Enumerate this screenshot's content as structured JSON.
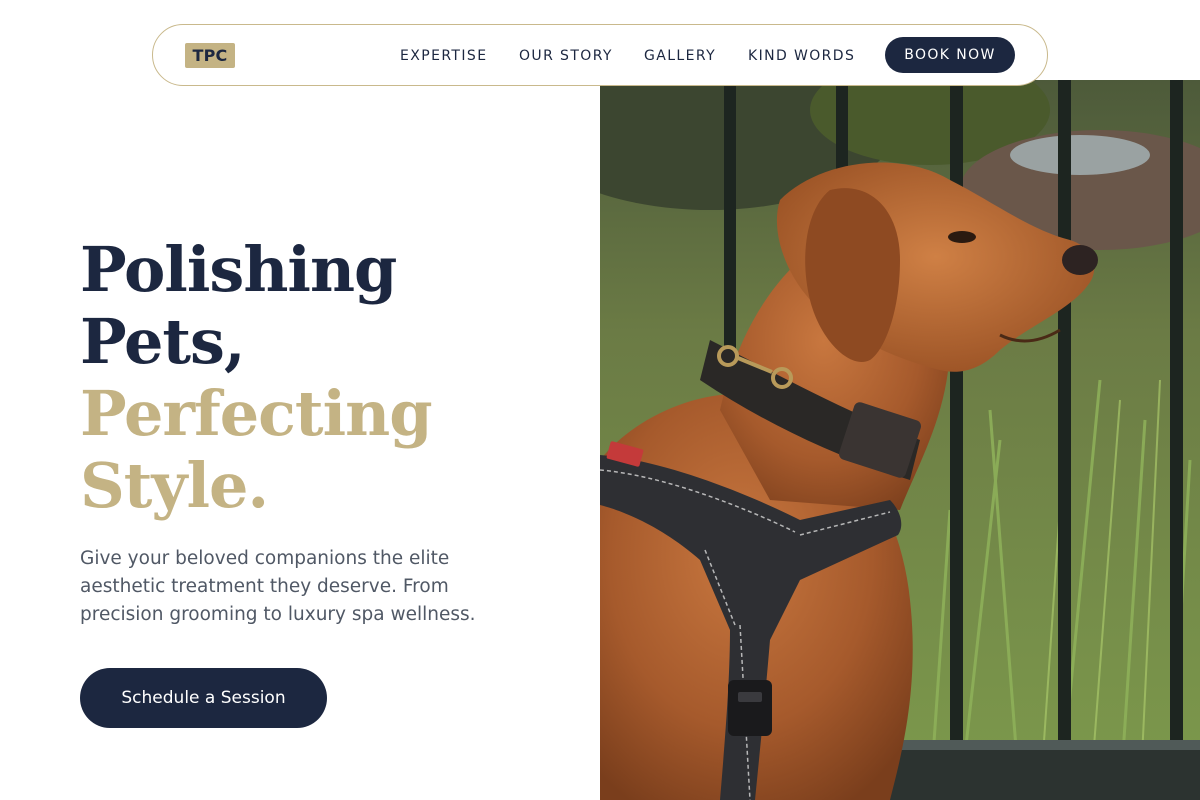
{
  "header": {
    "logo": "TPC",
    "nav": [
      {
        "label": "EXPERTISE"
      },
      {
        "label": "OUR STORY"
      },
      {
        "label": "GALLERY"
      },
      {
        "label": "KIND WORDS"
      }
    ],
    "book_label": "BOOK NOW"
  },
  "hero": {
    "headline": {
      "line1": "Polishing",
      "line2": "Pets,",
      "line3": "Perfecting",
      "line4": "Style."
    },
    "subtitle": "Give your beloved companions the elite aesthetic treatment they deserve. From precision grooming to luxury spa wellness.",
    "cta_label": "Schedule a Session",
    "image_alt": "photo-dog-in-harness"
  },
  "colors": {
    "navy": "#1c2740",
    "gold": "#c4b384",
    "body_text": "#505865",
    "border": "#c9b98c"
  }
}
